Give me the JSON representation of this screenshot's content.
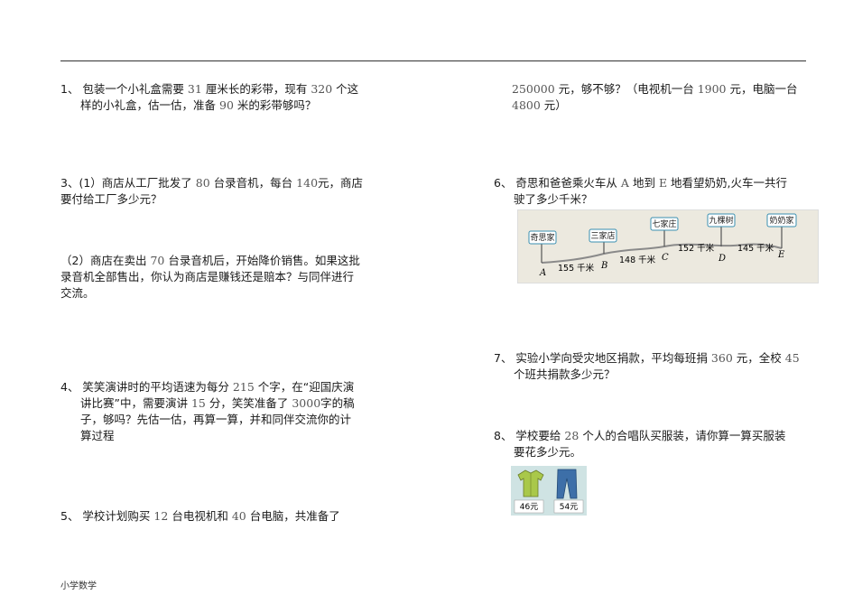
{
  "q1": {
    "prefix": "1、 包装一个小礼盒需要",
    "n1": "31",
    "t1": "厘米长的彩带，现有",
    "n2": "320",
    "t2": "个这",
    "line2a": "样的小礼盒，估一估，准备",
    "n3": "90",
    "line2b": "米的彩带够吗？"
  },
  "q3a": {
    "prefix": "3、(1）商店从工厂批发了",
    "n1": "80",
    "t1": "台录音机，每台",
    "n2": "140",
    "t2": "元，商店",
    "line2": "要付给工厂多少元？"
  },
  "q3b": {
    "line1a": "（2）商店在卖出",
    "n1": "70",
    "line1b": "台录音机后，开始降价销售。如果这批",
    "line2": "录音机全部售出，你认为商店是赚钱还是赔本？与同伴进行",
    "line3": "交流。"
  },
  "q4": {
    "p1": "4、 笑笑演讲时的平均语速为每分",
    "n1": "215",
    "p1b": "个字，在“迎国庆演",
    "p2a": "讲比赛”中，需要演讲",
    "n2": "15",
    "p2b": "分，笑笑准备了",
    "n3": "3000",
    "p2c": "字的稿",
    "p3": "子，够吗？先估一估，再算一算，并和同伴交流你的计",
    "p4": "算过程"
  },
  "q5": {
    "p1a": "5、 学校计划购买",
    "n1": "12",
    "p1b": "台电视机和",
    "n2": "40",
    "p1c": "台电脑，共准备了"
  },
  "q5cont": {
    "n1": "250000",
    "t1": "元，够不够？（电视机一台",
    "n2": "1900",
    "t2": "元，电脑一台",
    "n3": "4800",
    "t3": "元）"
  },
  "q6": {
    "p1a": "6、 奇思和爸爸乘火车从",
    "a": "A",
    "p1b": "地到",
    "e": "E",
    "p1c": "地看望奶奶,火车一共行",
    "p2": "驶了多少千米？"
  },
  "map": {
    "stations": [
      {
        "label": "奇思家",
        "letter": "A"
      },
      {
        "label": "三家店",
        "letter": "B"
      },
      {
        "label": "七家庄",
        "letter": "C"
      },
      {
        "label": "九棵树",
        "letter": "D"
      },
      {
        "label": "奶奶家",
        "letter": "E"
      }
    ],
    "distances": [
      "155 千米",
      "148 千米",
      "152 千米",
      "145 千米"
    ]
  },
  "q7": {
    "p1a": "7、 实验小学向受灾地区捐款，平均每班捐",
    "n1": "360",
    "p1b": "元，全校",
    "n2": "45",
    "p2": "个班共捐款多少元？"
  },
  "q8": {
    "p1a": "8、 学校要给",
    "n1": "28",
    "p1b": "个人的合唱队买服装，请你算一算买服装",
    "p2": "要花多少元。",
    "shirt_price": "46元",
    "pants_price": "54元"
  },
  "footer": "小学数学"
}
